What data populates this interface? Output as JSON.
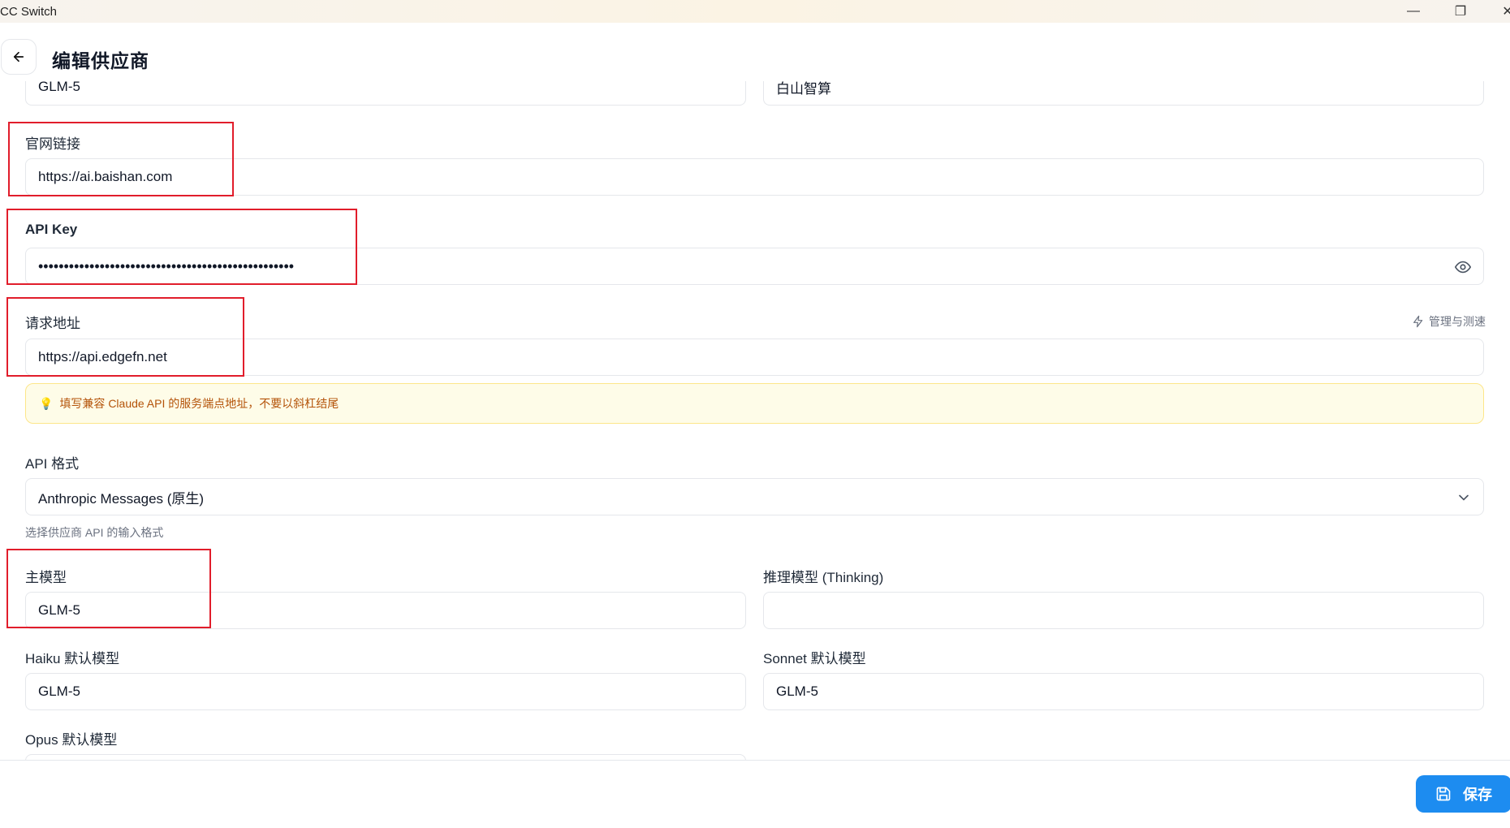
{
  "window": {
    "title": "CC Switch",
    "minimize": "—",
    "maximize": "❐",
    "close": "✕"
  },
  "header": {
    "title": "编辑供应商"
  },
  "top_row": {
    "left_value": "GLM-5",
    "right_value": "白山智算"
  },
  "website": {
    "label": "官网链接",
    "value": "https://ai.baishan.com"
  },
  "api_key": {
    "label": "API Key",
    "value": "••••••••••••••••••••••••••••••••••••••••••••••••••"
  },
  "endpoint": {
    "label": "请求地址",
    "value": "https://api.edgefn.net",
    "manage_label": "管理与测速",
    "tip": "填写兼容 Claude API 的服务端点地址，不要以斜杠结尾"
  },
  "api_format": {
    "label": "API 格式",
    "value": "Anthropic Messages (原生)",
    "hint": "选择供应商 API 的输入格式"
  },
  "models": {
    "main_label": "主模型",
    "main_value": "GLM-5",
    "thinking_label": "推理模型 (Thinking)",
    "thinking_value": "",
    "haiku_label": "Haiku 默认模型",
    "haiku_value": "GLM-5",
    "sonnet_label": "Sonnet 默认模型",
    "sonnet_value": "GLM-5",
    "opus_label": "Opus 默认模型"
  },
  "footer": {
    "save_label": "保存"
  },
  "colors": {
    "accent": "#1d8cf0",
    "highlight_box": "#e11d2b",
    "tip_bg": "#fefce8",
    "tip_text": "#b45309"
  },
  "icons": [
    "back-arrow-icon",
    "eye-icon",
    "lightning-icon",
    "chevron-down-icon",
    "save-icon",
    "bulb-icon"
  ]
}
